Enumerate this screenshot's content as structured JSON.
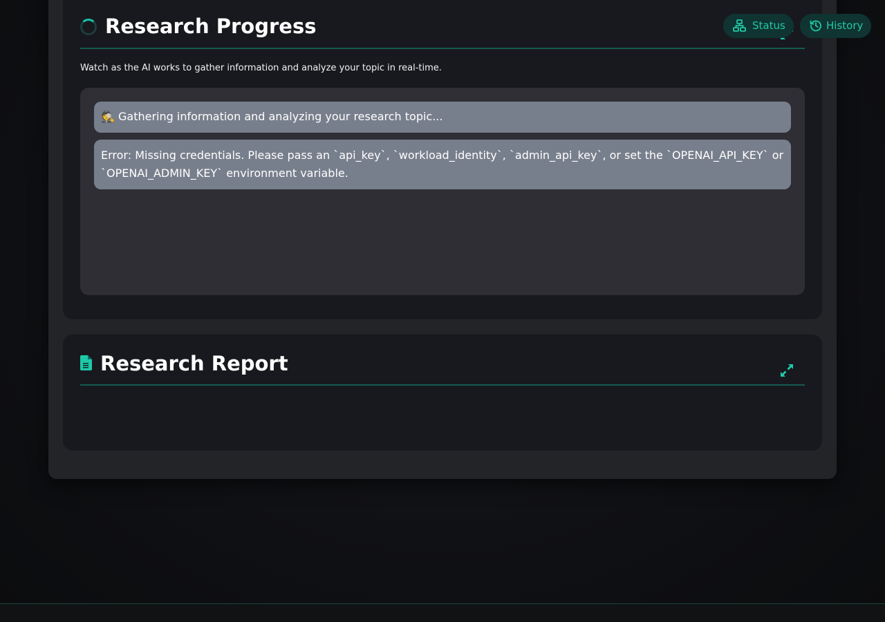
{
  "topbar": {
    "status_label": "Status",
    "history_label": "History"
  },
  "progress_card": {
    "title": "Research Progress",
    "subtitle": "Watch as the AI works to gather information and analyze your topic in real-time.",
    "logs": [
      {
        "emoji": "🕵️",
        "text": "Gathering information and analyzing your research topic..."
      },
      {
        "text": "Error: Missing credentials. Please pass an `api_key`, `workload_identity`, `admin_api_key`, or set the `OPENAI_API_KEY` or `OPENAI_ADMIN_KEY` environment variable."
      }
    ]
  },
  "report_card": {
    "title": "Research Report"
  },
  "colors": {
    "accent": "#1fc8a8",
    "card_bg": "#18191e",
    "log_bg": "#787f8c",
    "pill_bg": "#0f3432"
  }
}
